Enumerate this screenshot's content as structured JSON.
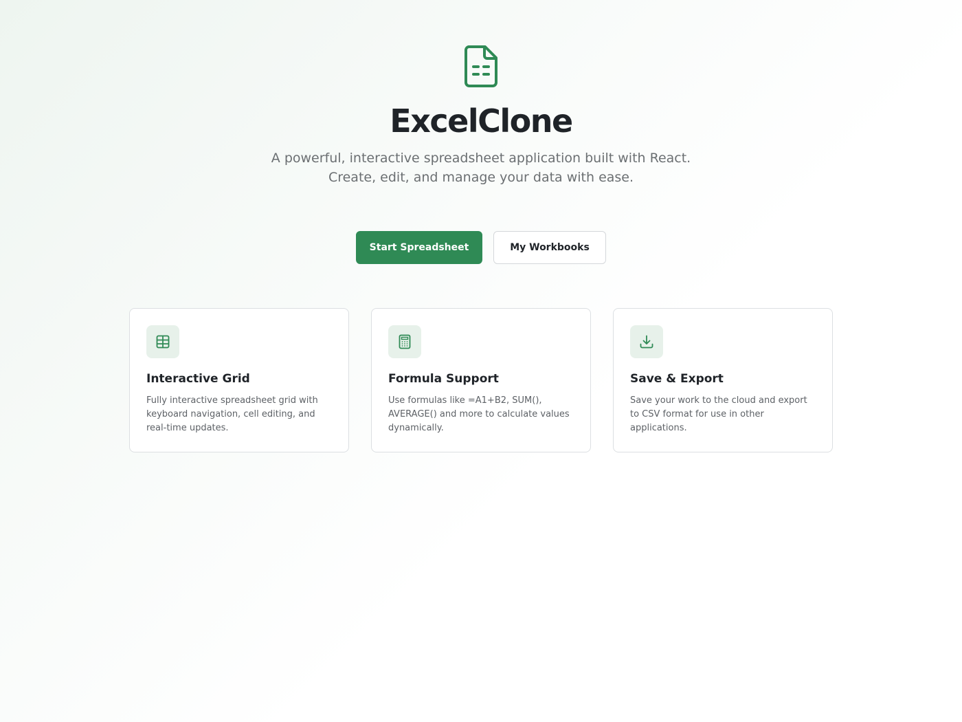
{
  "app": {
    "title": "ExcelClone",
    "subtitle": "A powerful, interactive spreadsheet application built with React. Create, edit, and manage your data with ease."
  },
  "actions": {
    "primary_label": "Start Spreadsheet",
    "secondary_label": "My Workbooks"
  },
  "features": [
    {
      "icon": "table-grid-icon",
      "title": "Interactive Grid",
      "description": "Fully interactive spreadsheet grid with keyboard navigation, cell editing, and real-time updates."
    },
    {
      "icon": "calculator-icon",
      "title": "Formula Support",
      "description": "Use formulas like =A1+B2, SUM(), AVERAGE() and more to calculate values dynamically."
    },
    {
      "icon": "download-icon",
      "title": "Save & Export",
      "description": "Save your work to the cloud and export to CSV format for use in other applications."
    }
  ],
  "colors": {
    "brand": "#2f8a55",
    "icon_bg": "#e7f1ea",
    "text": "#1f2328",
    "muted": "#6b6f72"
  }
}
